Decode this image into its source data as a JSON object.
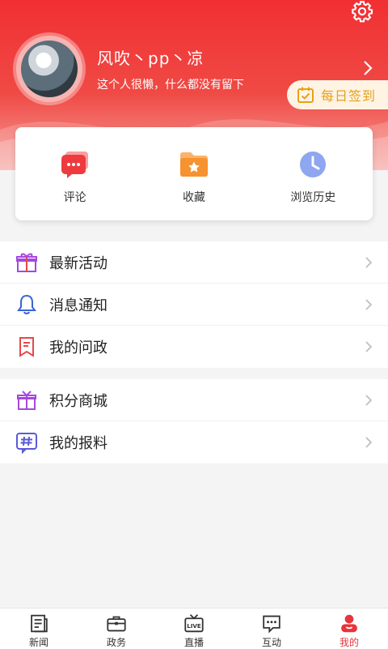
{
  "profile": {
    "username": "风吹丶pp丶凉",
    "bio": "这个人很懒，什么都没有留下"
  },
  "checkin": {
    "label": "每日签到"
  },
  "quick_actions": [
    {
      "label": "评论",
      "icon": "comment-icon"
    },
    {
      "label": "收藏",
      "icon": "favorites-folder-icon"
    },
    {
      "label": "浏览历史",
      "icon": "history-clock-icon"
    }
  ],
  "menu_group1": [
    {
      "label": "最新活动",
      "icon": "gift-icon"
    },
    {
      "label": "消息通知",
      "icon": "bell-icon"
    },
    {
      "label": "我的问政",
      "icon": "bookmark-icon"
    }
  ],
  "menu_group2": [
    {
      "label": "积分商城",
      "icon": "gift-box-icon"
    },
    {
      "label": "我的报料",
      "icon": "hashtag-icon"
    }
  ],
  "tabs": [
    {
      "label": "新闻",
      "icon": "newspaper-icon"
    },
    {
      "label": "政务",
      "icon": "briefcase-icon"
    },
    {
      "label": "直播",
      "icon": "live-tv-icon"
    },
    {
      "label": "互动",
      "icon": "chat-icon"
    },
    {
      "label": "我的",
      "icon": "user-icon",
      "active": true
    }
  ],
  "colors": {
    "brand_red": "#f12f33",
    "checkin_text": "#e8a01a",
    "active_tab": "#e8343a"
  }
}
